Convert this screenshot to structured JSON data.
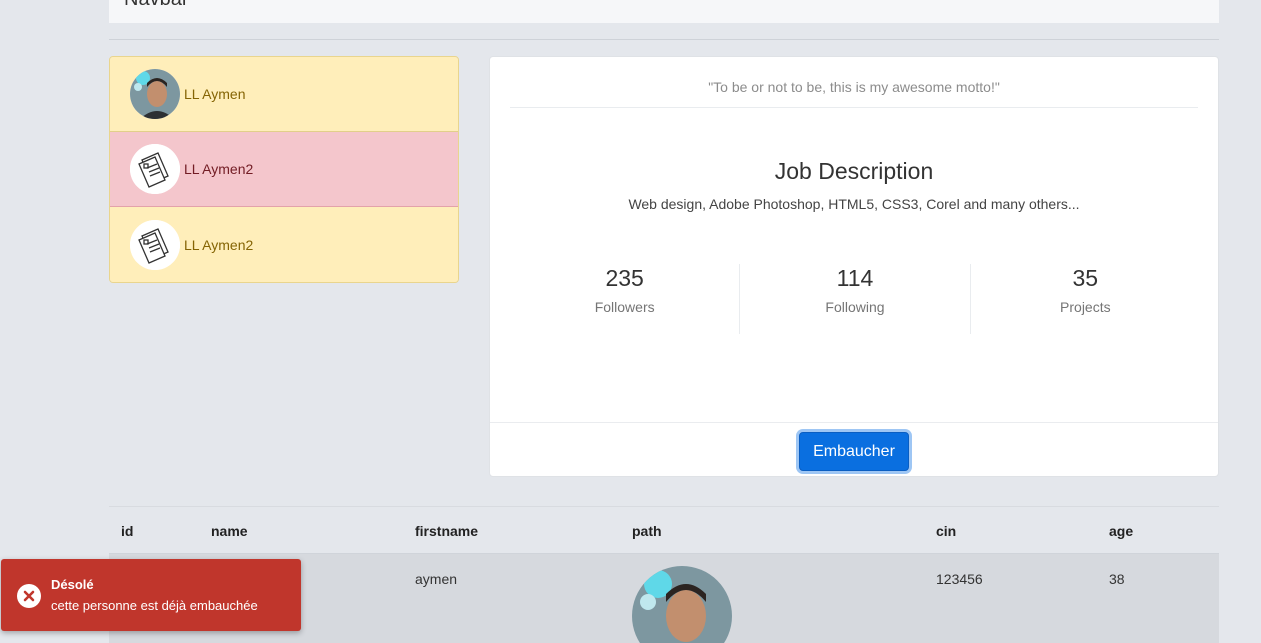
{
  "navbar": {
    "brand": "Navbar"
  },
  "list": {
    "items": [
      {
        "label": "LL Aymen",
        "avatar": "person-photo"
      },
      {
        "label": "LL Aymen2",
        "avatar": "document-sketch"
      },
      {
        "label": "LL Aymen2",
        "avatar": "document-sketch"
      }
    ]
  },
  "card": {
    "motto": "\"To be or not to be, this is my awesome motto!\"",
    "job_title": "Job Description",
    "job_desc": "Web design, Adobe Photoshop, HTML5, CSS3, Corel and many others...",
    "stats": [
      {
        "value": "235",
        "label": "Followers"
      },
      {
        "value": "114",
        "label": "Following"
      },
      {
        "value": "35",
        "label": "Projects"
      }
    ],
    "hire_button": "Embaucher"
  },
  "table": {
    "headers": [
      "id",
      "name",
      "firstname",
      "path",
      "cin",
      "age"
    ],
    "rows": [
      {
        "firstname": "aymen",
        "cin": "123456",
        "age": "38"
      }
    ]
  },
  "toast": {
    "title": "Désolé",
    "message": "cette personne est déjà embauchée"
  },
  "colors": {
    "warning_bg": "#ffeeba",
    "danger_bg": "#f4c6cc",
    "primary": "#0a6fe0",
    "toast_bg": "#c0362c"
  }
}
